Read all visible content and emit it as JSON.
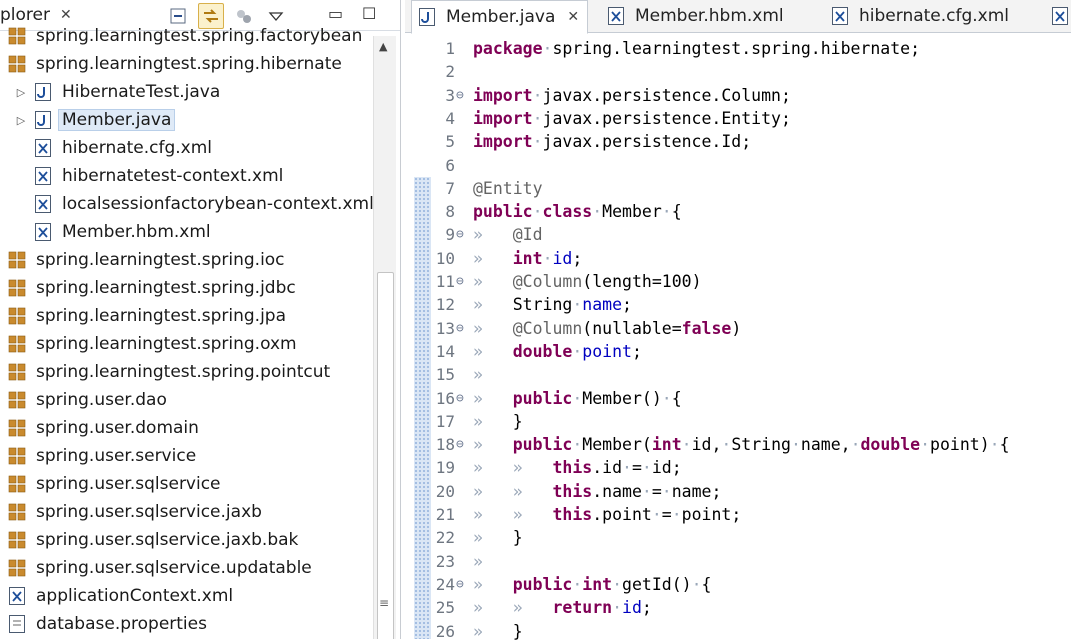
{
  "explorer": {
    "tab_label": "plorer",
    "close": "✕",
    "items": [
      {
        "label": "spring.learningtest.spring.factorybean",
        "icon": "package-icon",
        "indent": 0
      },
      {
        "label": "spring.learningtest.spring.hibernate",
        "icon": "package-icon",
        "indent": 0
      },
      {
        "label": "HibernateTest.java",
        "icon": "java-file-icon",
        "indent": 1,
        "arrow": "▷"
      },
      {
        "label": "Member.java",
        "icon": "java-file-icon",
        "indent": 1,
        "arrow": "▷",
        "selected": true
      },
      {
        "label": "hibernate.cfg.xml",
        "icon": "xml-file-icon",
        "indent": 1
      },
      {
        "label": "hibernatetest-context.xml",
        "icon": "xml-file-icon",
        "indent": 1
      },
      {
        "label": "localsessionfactorybean-context.xml",
        "icon": "xml-file-icon",
        "indent": 1
      },
      {
        "label": "Member.hbm.xml",
        "icon": "xml-file-icon",
        "indent": 1
      },
      {
        "label": "spring.learningtest.spring.ioc",
        "icon": "package-icon",
        "indent": 0
      },
      {
        "label": "spring.learningtest.spring.jdbc",
        "icon": "package-icon",
        "indent": 0
      },
      {
        "label": "spring.learningtest.spring.jpa",
        "icon": "package-icon",
        "indent": 0
      },
      {
        "label": "spring.learningtest.spring.oxm",
        "icon": "package-icon",
        "indent": 0
      },
      {
        "label": "spring.learningtest.spring.pointcut",
        "icon": "package-icon",
        "indent": 0
      },
      {
        "label": "spring.user.dao",
        "icon": "package-icon",
        "indent": 0
      },
      {
        "label": "spring.user.domain",
        "icon": "package-icon",
        "indent": 0
      },
      {
        "label": "spring.user.service",
        "icon": "package-icon",
        "indent": 0
      },
      {
        "label": "spring.user.sqlservice",
        "icon": "package-icon",
        "indent": 0
      },
      {
        "label": "spring.user.sqlservice.jaxb",
        "icon": "package-icon",
        "indent": 0
      },
      {
        "label": "spring.user.sqlservice.jaxb.bak",
        "icon": "package-icon",
        "indent": 0
      },
      {
        "label": "spring.user.sqlservice.updatable",
        "icon": "package-icon",
        "indent": 0
      },
      {
        "label": "applicationContext.xml",
        "icon": "xml-file-icon",
        "indent": 0
      },
      {
        "label": "database.properties",
        "icon": "properties-file-icon",
        "indent": 0
      }
    ]
  },
  "editor": {
    "tabs": [
      {
        "label": "Member.java",
        "icon": "java-file-icon",
        "active": true,
        "close": "✕"
      },
      {
        "label": "Member.hbm.xml",
        "icon": "xml-file-icon"
      },
      {
        "label": "hibernate.cfg.xml",
        "icon": "xml-file-icon"
      }
    ],
    "lines": [
      {
        "n": "1",
        "fold": "",
        "tokens": [
          [
            "kw",
            "package"
          ],
          [
            "ws",
            "·"
          ],
          [
            "",
            "spring.learningtest.spring.hibernate;"
          ]
        ]
      },
      {
        "n": "2",
        "fold": "",
        "tokens": []
      },
      {
        "n": "3",
        "fold": "⊖",
        "tokens": [
          [
            "kw",
            "import"
          ],
          [
            "ws",
            "·"
          ],
          [
            "",
            "javax.persistence.Column;"
          ]
        ]
      },
      {
        "n": "4",
        "fold": "",
        "tokens": [
          [
            "kw",
            "import"
          ],
          [
            "ws",
            "·"
          ],
          [
            "",
            "javax.persistence.Entity;"
          ]
        ]
      },
      {
        "n": "5",
        "fold": "",
        "tokens": [
          [
            "kw",
            "import"
          ],
          [
            "ws",
            "·"
          ],
          [
            "",
            "javax.persistence.Id;"
          ]
        ]
      },
      {
        "n": "6",
        "fold": "",
        "tokens": []
      },
      {
        "n": "7",
        "fold": "",
        "tokens": [
          [
            "ann",
            "@Entity"
          ]
        ]
      },
      {
        "n": "8",
        "fold": "",
        "tokens": [
          [
            "kw",
            "public"
          ],
          [
            "ws",
            "·"
          ],
          [
            "kw",
            "class"
          ],
          [
            "ws",
            "·"
          ],
          [
            "",
            "Member"
          ],
          [
            "ws",
            "·"
          ],
          [
            "",
            "{"
          ]
        ]
      },
      {
        "n": "9",
        "fold": "⊖",
        "tokens": [
          [
            "ws",
            "»   "
          ],
          [
            "ann",
            "@Id"
          ]
        ]
      },
      {
        "n": "10",
        "fold": "",
        "tokens": [
          [
            "ws",
            "»   "
          ],
          [
            "kw",
            "int"
          ],
          [
            "ws",
            "·"
          ],
          [
            "fld",
            "id"
          ],
          [
            "",
            ";"
          ]
        ]
      },
      {
        "n": "11",
        "fold": "⊖",
        "tokens": [
          [
            "ws",
            "»   "
          ],
          [
            "ann",
            "@Column"
          ],
          [
            "",
            "(length=100)"
          ]
        ]
      },
      {
        "n": "12",
        "fold": "",
        "tokens": [
          [
            "ws",
            "»   "
          ],
          [
            "",
            "String"
          ],
          [
            "ws",
            "·"
          ],
          [
            "fld",
            "name"
          ],
          [
            "",
            ";"
          ]
        ]
      },
      {
        "n": "13",
        "fold": "⊖",
        "tokens": [
          [
            "ws",
            "»   "
          ],
          [
            "ann",
            "@Column"
          ],
          [
            "",
            "(nullable="
          ],
          [
            "kw",
            "false"
          ],
          [
            "",
            ")"
          ]
        ]
      },
      {
        "n": "14",
        "fold": "",
        "tokens": [
          [
            "ws",
            "»   "
          ],
          [
            "kw",
            "double"
          ],
          [
            "ws",
            "·"
          ],
          [
            "fld",
            "point"
          ],
          [
            "",
            ";"
          ]
        ]
      },
      {
        "n": "15",
        "fold": "",
        "tokens": [
          [
            "ws",
            "»"
          ]
        ]
      },
      {
        "n": "16",
        "fold": "⊖",
        "tokens": [
          [
            "ws",
            "»   "
          ],
          [
            "kw",
            "public"
          ],
          [
            "ws",
            "·"
          ],
          [
            "",
            "Member()"
          ],
          [
            "ws",
            "·"
          ],
          [
            "",
            "{"
          ]
        ]
      },
      {
        "n": "17",
        "fold": "",
        "tokens": [
          [
            "ws",
            "»   "
          ],
          [
            "",
            "}"
          ]
        ]
      },
      {
        "n": "18",
        "fold": "⊖",
        "tokens": [
          [
            "ws",
            "»   "
          ],
          [
            "kw",
            "public"
          ],
          [
            "ws",
            "·"
          ],
          [
            "",
            "Member("
          ],
          [
            "kw",
            "int"
          ],
          [
            "ws",
            "·"
          ],
          [
            "",
            "id,"
          ],
          [
            "ws",
            "·"
          ],
          [
            "",
            "String"
          ],
          [
            "ws",
            "·"
          ],
          [
            "",
            "name,"
          ],
          [
            "ws",
            "·"
          ],
          [
            "kw",
            "double"
          ],
          [
            "ws",
            "·"
          ],
          [
            "",
            "point)"
          ],
          [
            "ws",
            "·"
          ],
          [
            "",
            "{"
          ]
        ]
      },
      {
        "n": "19",
        "fold": "",
        "tokens": [
          [
            "ws",
            "»   »   "
          ],
          [
            "kw",
            "this"
          ],
          [
            "",
            ".id"
          ],
          [
            "ws",
            "·"
          ],
          [
            "",
            "="
          ],
          [
            "ws",
            "·"
          ],
          [
            "",
            "id;"
          ]
        ]
      },
      {
        "n": "20",
        "fold": "",
        "tokens": [
          [
            "ws",
            "»   »   "
          ],
          [
            "kw",
            "this"
          ],
          [
            "",
            ".name"
          ],
          [
            "ws",
            "·"
          ],
          [
            "",
            "="
          ],
          [
            "ws",
            "·"
          ],
          [
            "",
            "name;"
          ]
        ]
      },
      {
        "n": "21",
        "fold": "",
        "tokens": [
          [
            "ws",
            "»   »   "
          ],
          [
            "kw",
            "this"
          ],
          [
            "",
            ".point"
          ],
          [
            "ws",
            "·"
          ],
          [
            "",
            "="
          ],
          [
            "ws",
            "·"
          ],
          [
            "",
            "point;"
          ]
        ]
      },
      {
        "n": "22",
        "fold": "",
        "tokens": [
          [
            "ws",
            "»   "
          ],
          [
            "",
            "}"
          ]
        ]
      },
      {
        "n": "23",
        "fold": "",
        "tokens": [
          [
            "ws",
            "»"
          ]
        ]
      },
      {
        "n": "24",
        "fold": "⊖",
        "tokens": [
          [
            "ws",
            "»   "
          ],
          [
            "kw",
            "public"
          ],
          [
            "ws",
            "·"
          ],
          [
            "kw",
            "int"
          ],
          [
            "ws",
            "·"
          ],
          [
            "",
            "getId()"
          ],
          [
            "ws",
            "·"
          ],
          [
            "",
            "{"
          ]
        ]
      },
      {
        "n": "25",
        "fold": "",
        "tokens": [
          [
            "ws",
            "»   »   "
          ],
          [
            "kw",
            "return"
          ],
          [
            "ws",
            "·"
          ],
          [
            "fld",
            "id"
          ],
          [
            "",
            ";"
          ]
        ]
      },
      {
        "n": "26",
        "fold": "",
        "tokens": [
          [
            "ws",
            "»   "
          ],
          [
            "",
            "}"
          ]
        ]
      }
    ]
  }
}
